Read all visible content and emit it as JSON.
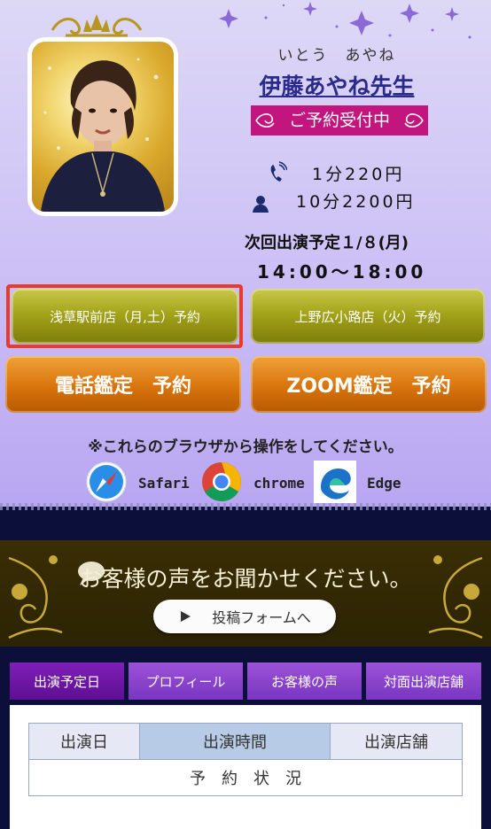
{
  "profile": {
    "kana": "いとう　あやね",
    "name": "伊藤あやね先生",
    "status_badge": "ご予約受付中",
    "price_1": "1分220円",
    "price_2": "10分2200円",
    "next_label": "次回出演予定１/８(月)",
    "next_time": "14:00〜18:00"
  },
  "reservation_buttons": {
    "asakusa": "浅草駅前店（月,土）予約",
    "ueno": "上野広小路店（火）予約",
    "phone": "電話鑑定　予約",
    "zoom": "ZOOM鑑定　予約"
  },
  "browser_notice": "※これらのブラウザから操作をしてください。",
  "browsers": [
    "Safari",
    "chrome",
    "Edge"
  ],
  "voice": {
    "title": "お客様の声をお聞かせください。",
    "button": "投稿フォームへ"
  },
  "tabs": [
    "出演予定日",
    "プロフィール",
    "お客様の声",
    "対面出演店舗"
  ],
  "schedule_table": {
    "headers": [
      "出演日",
      "出演時間",
      "出演店舗"
    ],
    "status_row": "予　約　状　況"
  },
  "colors": {
    "badge": "#c3157e",
    "name": "#2a2a8a",
    "highlight_border": "#e83b2d",
    "olive_button": "#a4a31a",
    "orange_button": "#d8740c",
    "tab_active": "#6a149f",
    "tab": "#8a45cc"
  }
}
